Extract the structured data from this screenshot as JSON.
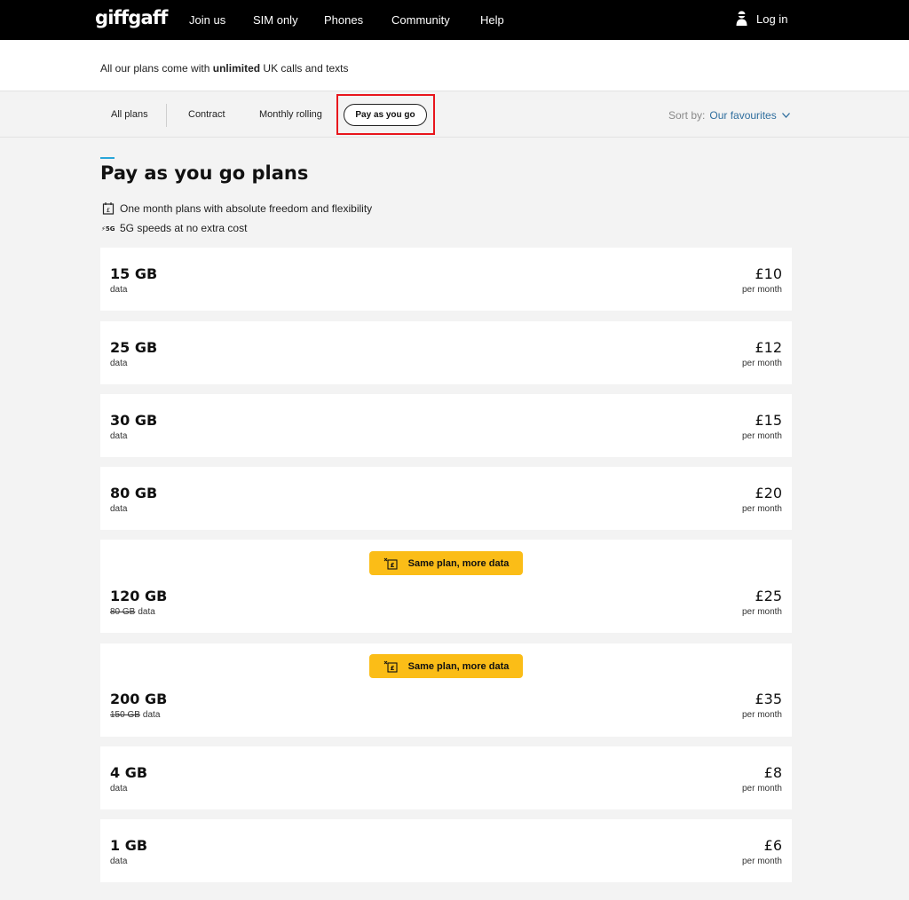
{
  "brand": "giffgaff",
  "nav": {
    "links": [
      "Join us",
      "SIM only",
      "Phones",
      "Community",
      "Help"
    ],
    "login": "Log in"
  },
  "info": {
    "prefix": "All our plans come with ",
    "bold": "unlimited",
    "suffix": " UK calls and texts"
  },
  "tabs": {
    "items": [
      "All plans",
      "Contract",
      "Monthly rolling"
    ],
    "active": "Pay as you go",
    "sort_label": "Sort by:",
    "sort_value": "Our favourites"
  },
  "section": {
    "title": "Pay as you go plans",
    "features": [
      {
        "icon": "calendar-icon",
        "text": "One month plans with absolute freedom and flexibility"
      },
      {
        "icon": "5g-icon",
        "text": "5G speeds at no extra cost"
      }
    ]
  },
  "plans": [
    {
      "data": "15 GB",
      "sub": "data",
      "price": "£10",
      "per": "per month"
    },
    {
      "data": "25 GB",
      "sub": "data",
      "price": "£12",
      "per": "per month"
    },
    {
      "data": "30 GB",
      "sub": "data",
      "price": "£15",
      "per": "per month"
    },
    {
      "data": "80 GB",
      "sub": "data",
      "price": "£20",
      "per": "per month"
    },
    {
      "data": "120 GB",
      "old": "80 GB",
      "sub": "data",
      "price": "£25",
      "per": "per month",
      "promo": "Same plan, more data"
    },
    {
      "data": "200 GB",
      "old": "150 GB",
      "sub": "data",
      "price": "£35",
      "per": "per month",
      "promo": "Same plan, more data"
    },
    {
      "data": "4 GB",
      "sub": "data",
      "price": "£8",
      "per": "per month"
    },
    {
      "data": "1 GB",
      "sub": "data",
      "price": "£6",
      "per": "per month"
    }
  ],
  "colors": {
    "topbar": "#000000",
    "promo": "#fbbd17",
    "accent": "#29a6d9",
    "highlight": "#e8151c",
    "sort_link": "#2f6e9e"
  }
}
